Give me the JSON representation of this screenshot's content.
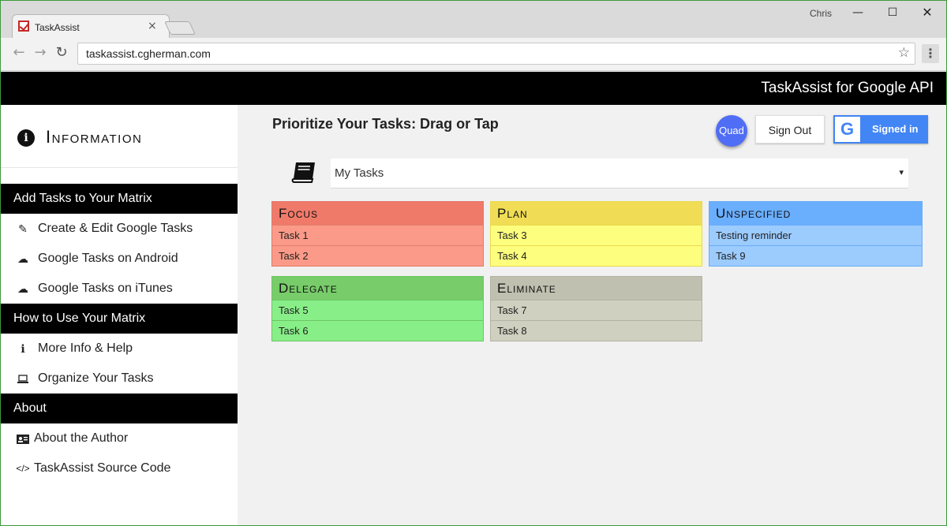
{
  "browser": {
    "tab_title": "TaskAssist",
    "tab_close": "×",
    "user": "Chris",
    "url": "taskassist.cgherman.com",
    "min": "—",
    "max": "☐",
    "close": "✕",
    "back": "←",
    "forward": "→",
    "reload": "↻",
    "star": "☆",
    "menu": "⋮"
  },
  "header": {
    "title": "TaskAssist for Google API"
  },
  "sidebar": {
    "info_icon": "i",
    "info_title": "Information",
    "sections": [
      {
        "title": "Add Tasks to Your Matrix",
        "items": [
          {
            "icon": "edit-icon",
            "glyph": "✎",
            "label": "Create & Edit Google Tasks"
          },
          {
            "icon": "cloud-download-icon",
            "glyph": "☁",
            "label": "Google Tasks on Android"
          },
          {
            "icon": "cloud-download-icon",
            "glyph": "☁",
            "label": "Google Tasks on iTunes"
          }
        ]
      },
      {
        "title": "How to Use Your Matrix",
        "items": [
          {
            "icon": "info-icon",
            "glyph": "ℹ",
            "label": "More Info & Help"
          },
          {
            "icon": "laptop-icon",
            "glyph": "💻",
            "label": "Organize Your Tasks"
          }
        ]
      },
      {
        "title": "About",
        "items": [
          {
            "icon": "id-card-icon",
            "glyph": "▤",
            "label": "About the Author"
          },
          {
            "icon": "code-icon",
            "glyph": "</>",
            "label": "TaskAssist Source Code"
          }
        ]
      }
    ]
  },
  "main": {
    "title": "Prioritize Your Tasks: Drag or Tap",
    "quad_button": "Quad",
    "sign_out": "Sign Out",
    "google_letter": "G",
    "signed_in": "Signed in",
    "tasklist_selected": "My Tasks",
    "tasklist_arrow": "▾"
  },
  "quadrants": {
    "focus": {
      "title": "Focus",
      "tasks": [
        "Task 1",
        "Task 2"
      ]
    },
    "plan": {
      "title": "Plan",
      "tasks": [
        "Task 3",
        "Task 4"
      ]
    },
    "unspecified": {
      "title": "Unspecified",
      "tasks": [
        "Testing reminder",
        "Task 9"
      ]
    },
    "delegate": {
      "title": "Delegate",
      "tasks": [
        "Task 5",
        "Task 6"
      ]
    },
    "eliminate": {
      "title": "Eliminate",
      "tasks": [
        "Task 7",
        "Task 8"
      ]
    }
  },
  "colors": {
    "focus": "#f07a6a",
    "plan": "#f0dd55",
    "unspecified": "#6aaefe",
    "delegate": "#78cc6a",
    "eliminate": "#c0c0b0",
    "accent": "#4285f4"
  }
}
